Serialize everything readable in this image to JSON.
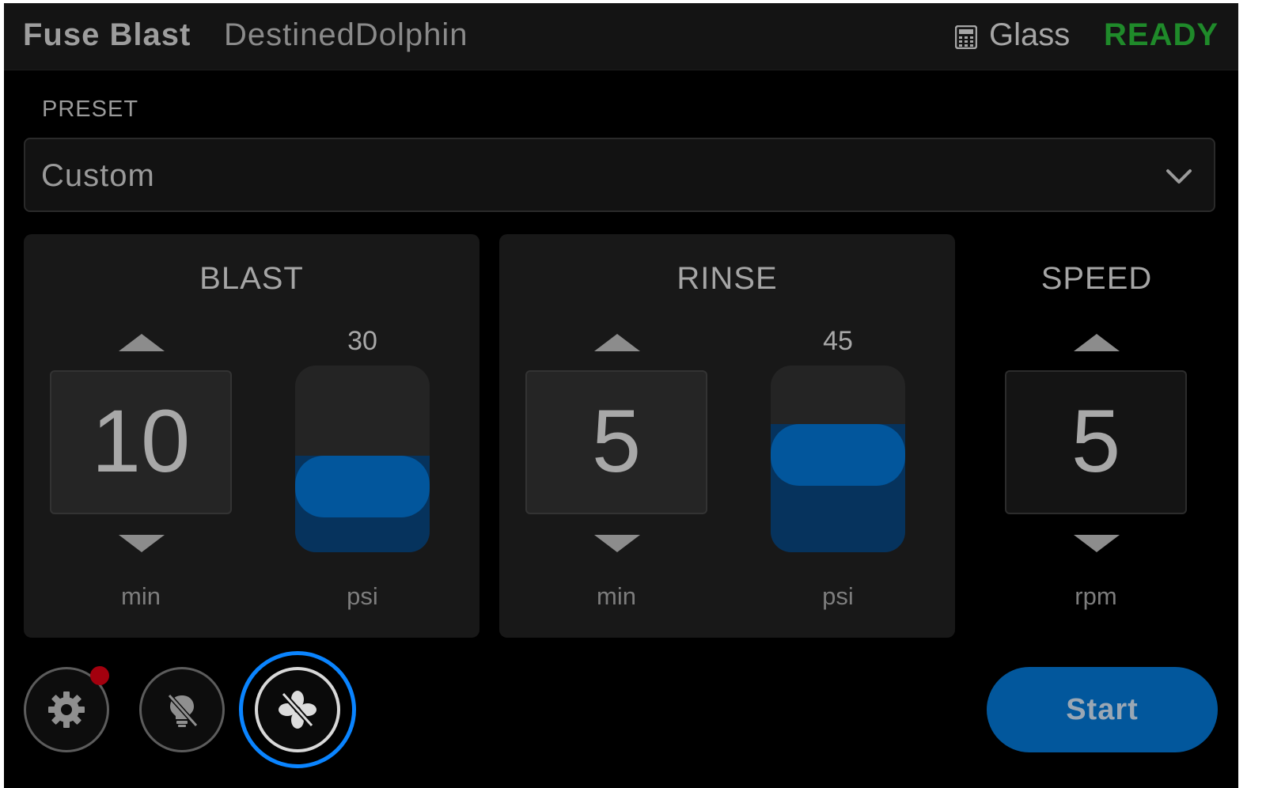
{
  "header": {
    "app_name": "Fuse Blast",
    "device_name": "DestinedDolphin",
    "mode_icon": "calculator-icon",
    "mode_label": "Glass",
    "status": "READY",
    "status_color": "#1f8a2a"
  },
  "preset": {
    "label": "PRESET",
    "value": "Custom"
  },
  "blast": {
    "title": "BLAST",
    "time_value": "10",
    "time_unit": "min",
    "pressure_value": "30",
    "pressure_unit": "psi",
    "pressure_fill": 0.35
  },
  "rinse": {
    "title": "RINSE",
    "time_value": "5",
    "time_unit": "min",
    "pressure_value": "45",
    "pressure_unit": "psi",
    "pressure_fill": 0.52
  },
  "speed": {
    "title": "SPEED",
    "value": "5",
    "unit": "rpm"
  },
  "controls": {
    "settings_icon": "gear-icon",
    "light_icon": "lightbulb-off-icon",
    "fan_icon": "fan-off-icon",
    "start_label": "Start",
    "accent_color": "#02569c"
  }
}
